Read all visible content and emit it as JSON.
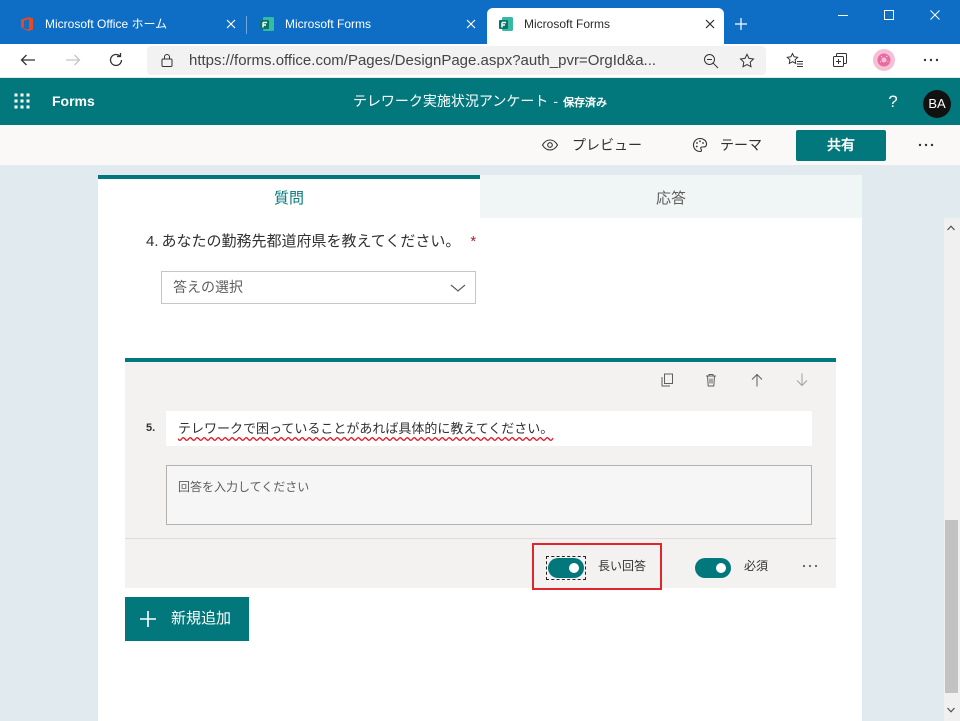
{
  "browser": {
    "tabs": [
      {
        "title": "Microsoft Office ホーム",
        "icon": "office-icon",
        "active": false
      },
      {
        "title": "Microsoft Forms",
        "icon": "forms-icon",
        "active": false
      },
      {
        "title": "Microsoft Forms",
        "icon": "forms-icon",
        "active": true
      }
    ],
    "new_tab_icon": "plus-icon",
    "window_controls": [
      "minimize-icon",
      "maximize-icon",
      "close-icon"
    ],
    "nav_icons": [
      "back-arrow-icon",
      "forward-arrow-icon",
      "refresh-icon"
    ],
    "address": {
      "url": "https://forms.office.com/Pages/DesignPage.aspx?auth_pvr=OrgId&a...",
      "secure_icon": "lock-icon",
      "zoom_icon": "zoom-out-icon",
      "favorite_icon": "star-icon"
    },
    "toolbar_icons": [
      "favorites-icon",
      "collections-icon",
      "profile-avatar",
      "more-icon"
    ]
  },
  "app": {
    "launcher_icon": "waffle-icon",
    "name": "Forms",
    "form_title": "テレワーク実施状況アンケート",
    "title_separator": "-",
    "save_status": "保存済み",
    "help_label": "?",
    "avatar_initials": "BA"
  },
  "toolbar": {
    "preview": {
      "label": "プレビュー",
      "icon": "eye-icon"
    },
    "theme": {
      "label": "テーマ",
      "icon": "palette-icon"
    },
    "share": {
      "label": "共有"
    },
    "more_icon": "more-icon"
  },
  "form": {
    "tabs": [
      {
        "label": "質問",
        "active": true
      },
      {
        "label": "応答",
        "active": false
      }
    ],
    "questions": [
      {
        "number": "4.",
        "title": "あなたの勤務先都道府県を教えてください。",
        "required_mark": "*",
        "placeholder": "答えの選択",
        "dropdown_icon": "chevron-down-icon"
      },
      {
        "number": "5.",
        "title": "テレワークで困っていることがあれば具体的に教えてください。",
        "placeholder": "回答を入力してください",
        "actions": [
          "copy-icon",
          "delete-icon",
          "move-up-icon",
          "move-down-icon"
        ],
        "long_answer": {
          "label": "長い回答",
          "on": true
        },
        "required": {
          "label": "必須",
          "on": true
        },
        "more_icon": "more-icon"
      }
    ],
    "add_new": {
      "label": "新規追加",
      "icon": "plus-icon"
    }
  },
  "colors": {
    "title_bar": "#0e6ec6",
    "accent": "#03787c",
    "background": "#e1ebef",
    "required": "#a4262c",
    "highlight": "#e0262c"
  }
}
